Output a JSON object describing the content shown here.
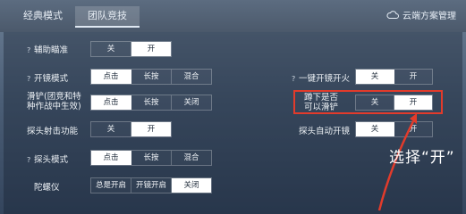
{
  "tabs": [
    {
      "label": "经典模式",
      "active": false
    },
    {
      "label": "团队竞技",
      "active": true
    }
  ],
  "cloud_action": {
    "label": "云端方案管理",
    "icon": "cloud-icon"
  },
  "left_settings": [
    {
      "label": "辅助瞄准",
      "help": true,
      "options": [
        "关",
        "开"
      ],
      "selected": "开"
    },
    {
      "label": "开镜模式",
      "help": true,
      "options": [
        "点击",
        "长按",
        "混合"
      ],
      "selected": "点击"
    },
    {
      "label": "滑铲(团竞和特种作战中生效)",
      "help": false,
      "options": [
        "点击",
        "长按",
        "关闭"
      ],
      "selected": "点击"
    },
    {
      "label": "探头射击功能",
      "help": false,
      "options": [
        "关",
        "开"
      ],
      "selected": "开"
    },
    {
      "label": "探头模式",
      "help": true,
      "options": [
        "点击",
        "长按",
        "混合"
      ],
      "selected": "点击"
    },
    {
      "label": "陀螺仪",
      "help": false,
      "options": [
        "总是开启",
        "开镜开启",
        "关闭"
      ],
      "selected": "关闭"
    }
  ],
  "right_settings": [
    {
      "label": "一键开镜开火",
      "help": true,
      "options": [
        "关",
        "开"
      ],
      "selected": "关"
    },
    {
      "label": "蹲下是否可以滑铲",
      "help": false,
      "options": [
        "关",
        "开"
      ],
      "selected": "开",
      "highlighted": true
    },
    {
      "label": "探头自动开镜",
      "help": false,
      "options": [
        "关",
        "开"
      ],
      "selected": "关"
    }
  ],
  "annotation": {
    "text": "选择“开”",
    "color": "#e23b2b"
  },
  "colors": {
    "selected_bg": "#ffffff",
    "highlight": "#e23b2b"
  }
}
